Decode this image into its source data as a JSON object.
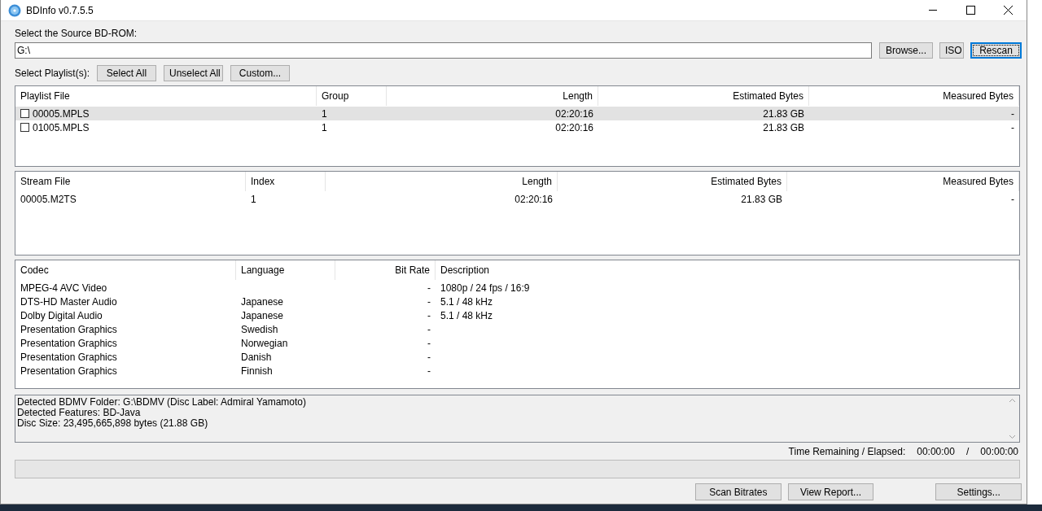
{
  "window": {
    "title": "BDInfo v0.7.5.5"
  },
  "source": {
    "label": "Select the Source BD-ROM:",
    "value": "G:\\",
    "buttons": [
      {
        "label": "Browse...",
        "default": false
      },
      {
        "label": "ISO",
        "default": false
      },
      {
        "label": "Rescan",
        "default": true
      }
    ]
  },
  "playlist_select": {
    "label": "Select Playlist(s):",
    "buttons": [
      "Select All",
      "Unselect All",
      "Custom..."
    ]
  },
  "playlists": {
    "columns": [
      {
        "label": "Playlist File"
      },
      {
        "label": "Group"
      },
      {
        "label": "Length"
      },
      {
        "label": "Estimated Bytes"
      },
      {
        "label": "Measured Bytes"
      }
    ],
    "rows": [
      {
        "checked": false,
        "selected": true,
        "cells": [
          "00005.MPLS",
          "1",
          "02:20:16",
          "21.83 GB",
          "-"
        ]
      },
      {
        "checked": false,
        "selected": false,
        "cells": [
          "01005.MPLS",
          "1",
          "02:20:16",
          "21.83 GB",
          "-"
        ]
      }
    ]
  },
  "streams": {
    "columns": [
      {
        "label": "Stream File"
      },
      {
        "label": "Index"
      },
      {
        "label": "Length"
      },
      {
        "label": "Estimated Bytes"
      },
      {
        "label": "Measured Bytes"
      }
    ],
    "rows": [
      {
        "cells": [
          "00005.M2TS",
          "1",
          "02:20:16",
          "21.83 GB",
          "-"
        ]
      }
    ]
  },
  "codecs": {
    "columns": [
      {
        "label": "Codec"
      },
      {
        "label": "Language"
      },
      {
        "label": "Bit Rate"
      },
      {
        "label": "Description"
      }
    ],
    "rows": [
      {
        "cells": [
          "MPEG-4 AVC Video",
          "",
          "-",
          "1080p / 24 fps / 16:9"
        ]
      },
      {
        "cells": [
          "DTS-HD Master Audio",
          "Japanese",
          "-",
          "5.1 / 48 kHz"
        ]
      },
      {
        "cells": [
          "Dolby Digital Audio",
          "Japanese",
          "-",
          "5.1 / 48 kHz"
        ]
      },
      {
        "cells": [
          "Presentation Graphics",
          "Swedish",
          "-",
          ""
        ]
      },
      {
        "cells": [
          "Presentation Graphics",
          "Norwegian",
          "-",
          ""
        ]
      },
      {
        "cells": [
          "Presentation Graphics",
          "Danish",
          "-",
          ""
        ]
      },
      {
        "cells": [
          "Presentation Graphics",
          "Finnish",
          "-",
          ""
        ]
      }
    ]
  },
  "log": {
    "lines": [
      "Detected BDMV Folder: G:\\BDMV (Disc Label: Admiral Yamamoto)",
      "Detected Features: BD-Java",
      "Disc Size: 23,495,665,898 bytes (21.88 GB)"
    ]
  },
  "time": {
    "label": "Time Remaining / Elapsed:",
    "remaining": "00:00:00",
    "separator": "/",
    "elapsed": "00:00:00"
  },
  "progress": {
    "level": 0
  },
  "bottom_buttons": [
    "Scan Bitrates",
    "View Report...",
    "Settings..."
  ]
}
